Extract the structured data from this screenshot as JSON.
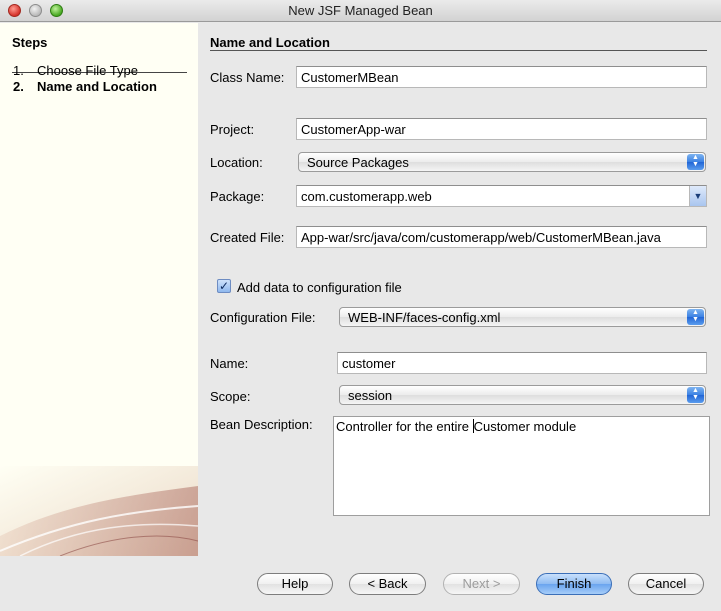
{
  "window": {
    "title": "New JSF Managed Bean"
  },
  "steps": {
    "heading": "Steps",
    "items": [
      {
        "number": "1.",
        "label": "Choose File Type"
      },
      {
        "number": "2.",
        "label": "Name and Location"
      }
    ]
  },
  "form": {
    "section_title": "Name and Location",
    "class_name": {
      "label": "Class Name:",
      "value": "CustomerMBean"
    },
    "project": {
      "label": "Project:",
      "value": "CustomerApp-war"
    },
    "location": {
      "label": "Location:",
      "value": "Source Packages"
    },
    "package": {
      "label": "Package:",
      "value": "com.customerapp.web"
    },
    "created_file": {
      "label": "Created File:",
      "value": "App-war/src/java/com/customerapp/web/CustomerMBean.java"
    },
    "add_config": {
      "label": "Add data to configuration file",
      "checked": true
    },
    "config_file": {
      "label": "Configuration File:",
      "value": "WEB-INF/faces-config.xml"
    },
    "name": {
      "label": "Name:",
      "value": "customer"
    },
    "scope": {
      "label": "Scope:",
      "value": "session"
    },
    "bean_description": {
      "label": "Bean Description:",
      "value_before_caret": "Controller for the entire ",
      "value_after_caret": "Customer module"
    }
  },
  "buttons": {
    "help": "Help",
    "back": "< Back",
    "next": "Next >",
    "finish": "Finish",
    "cancel": "Cancel"
  },
  "colors": {
    "accent": "#3a80e3",
    "steps_background": "#fffff4",
    "window_background": "#e8e8e8"
  }
}
